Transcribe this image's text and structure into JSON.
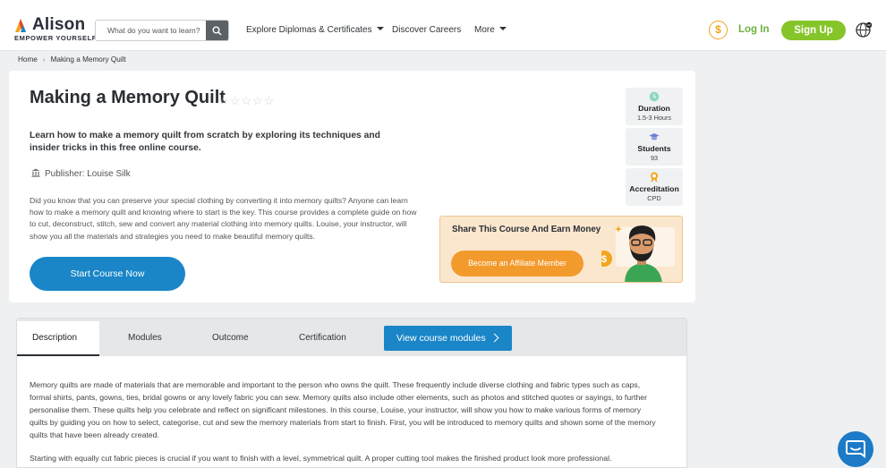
{
  "header": {
    "logo": {
      "name": "Alison",
      "tagline": "EMPOWER YOURSELF"
    },
    "search": {
      "placeholder": "What do you want to learn?"
    },
    "nav": {
      "explore": "Explore Diplomas & Certificates",
      "careers": "Discover Careers",
      "more": "More"
    },
    "login_label": "Log In",
    "signup_label": "Sign Up",
    "colors": {
      "brand_green": "#86c52a",
      "accent_blue": "#1a86c8",
      "orange": "#f39a2c"
    }
  },
  "breadcrumb": {
    "home": "Home",
    "current": "Making a Memory Quilt"
  },
  "course": {
    "title": "Making a Memory Quilt",
    "rating_stars": "☆☆☆☆☆",
    "lead": "Learn how to make a memory quilt from scratch by exploring its techniques and insider tricks in this free online course.",
    "publisher": "Publisher: Louise Silk",
    "description": "Did you know that you can preserve your special clothing by converting it into memory quilts? Anyone can learn how to make a memory quilt and knowing where to start is the key. This course provides a complete guide on how to cut, deconstruct, stitch, sew and convert any material clothing into memory quilts. Louise, your instructor, will show you all the materials and strategies you need to make beautiful memory quilts.",
    "start_label": "Start Course Now"
  },
  "stats": {
    "duration": {
      "label": "Duration",
      "value": "1.5-3 Hours"
    },
    "students": {
      "label": "Students",
      "value": "93"
    },
    "accreditation": {
      "label": "Accreditation",
      "value": "CPD"
    }
  },
  "affiliate": {
    "title": "Share This Course And Earn Money",
    "button": "Become an Affiliate Member"
  },
  "tabs": {
    "description": "Description",
    "modules": "Modules",
    "outcome": "Outcome",
    "certification": "Certification",
    "view_modules": "View course modules"
  },
  "content": {
    "p1": "Memory quilts are made of materials that are memorable and important to the person who owns the quilt. These frequently include diverse clothing and fabric types such as caps, formal shirts, pants, gowns, ties, bridal gowns or any lovely fabric you can sew. Memory quilts also include other elements, such as photos and stitched quotes or sayings, to further personalise them. These quilts help you celebrate and reflect on significant milestones. In this course, Louise, your instructor, will show you how to make various forms of memory quilts by guiding you on how to select, categorise, cut and sew the memory materials from start to finish. First, you will be introduced to memory quilts and shown some of the memory quilts that have been already created.",
    "p2": "Starting with equally cut fabric pieces is crucial if you want to finish with a level, symmetrical quilt. A proper cutting tool makes the finished product look more professional."
  }
}
